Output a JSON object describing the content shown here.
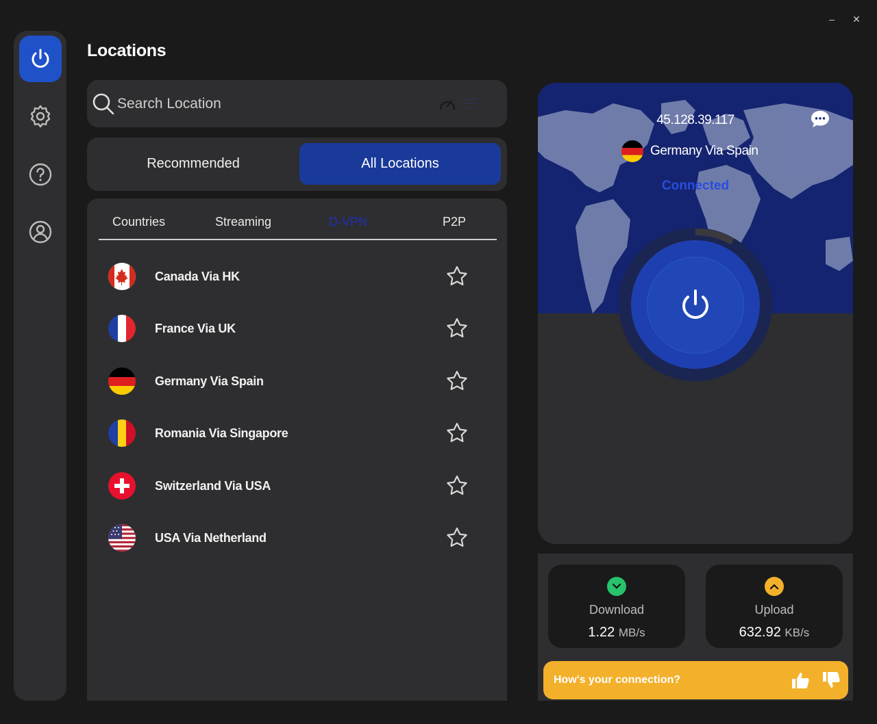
{
  "window": {
    "minimize": "–",
    "close": "✕"
  },
  "sidebar": {
    "items": [
      {
        "icon": "power-icon",
        "active": true
      },
      {
        "icon": "gear-icon"
      },
      {
        "icon": "help-icon"
      },
      {
        "icon": "account-icon"
      }
    ]
  },
  "page_title": "Locations",
  "search": {
    "placeholder": "Search Location"
  },
  "main_tabs": {
    "recommended": "Recommended",
    "all": "All Locations"
  },
  "sub_tabs": {
    "countries": "Countries",
    "streaming": "Streaming",
    "dvpn": "D-VPN",
    "p2p": "P2P"
  },
  "locations": [
    {
      "name": "Canada Via HK",
      "flag": "canada"
    },
    {
      "name": "France Via UK",
      "flag": "france"
    },
    {
      "name": "Germany Via Spain",
      "flag": "germany"
    },
    {
      "name": "Romania Via Singapore",
      "flag": "romania"
    },
    {
      "name": "Switzerland Via USA",
      "flag": "switzerland"
    },
    {
      "name": "USA Via Netherland",
      "flag": "usa"
    }
  ],
  "connection": {
    "ip": "45.128.39.117",
    "location": "Germany Via Spain",
    "status": "Connected"
  },
  "stats": {
    "download": {
      "label": "Download",
      "value": "1.22",
      "unit": "MB/s"
    },
    "upload": {
      "label": "Upload",
      "value": "632.92",
      "unit": "KB/s"
    }
  },
  "feedback": {
    "prompt": "How's your connection?"
  },
  "colors": {
    "accent": "#1f52c8",
    "feedback": "#f3b02b",
    "download": "#27c26a",
    "upload": "#f3b02b"
  }
}
